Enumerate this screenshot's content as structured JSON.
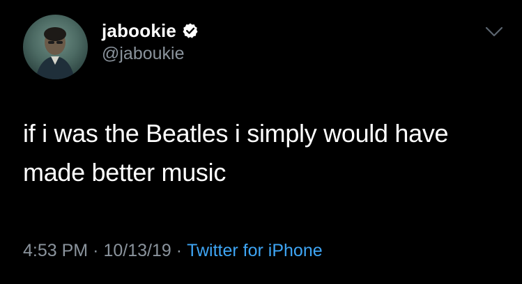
{
  "tweet": {
    "display_name": "jabookie",
    "handle": "@jaboukie",
    "verified": true,
    "text_line_1": "if i was the Beatles i simply would have",
    "text_line_2": "made better music",
    "time": "4:53 PM",
    "separator": "·",
    "date": "10/13/19",
    "source": "Twitter for iPhone"
  },
  "icons": {
    "verified": "verified-badge-icon",
    "menu": "chevron-down-icon"
  },
  "colors": {
    "background": "#000000",
    "primary_text": "#ffffff",
    "secondary_text": "#8a939c",
    "link": "#3ea5f4"
  }
}
